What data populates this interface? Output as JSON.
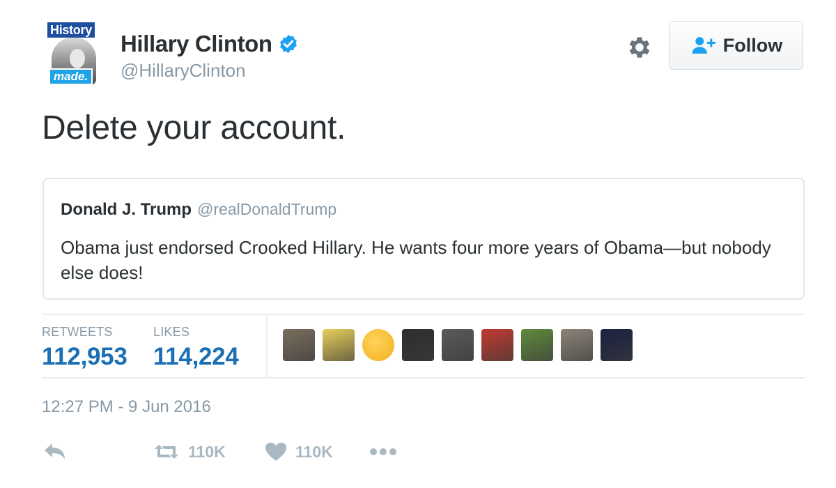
{
  "author": {
    "name": "Hillary Clinton",
    "handle": "@HillaryClinton",
    "avatar_text_top": "History",
    "avatar_text_bottom": "made.",
    "verified": true
  },
  "follow_button": {
    "label": "Follow",
    "icon": "add-user-icon"
  },
  "settings_icon": "gear-icon",
  "tweet": {
    "text": "Delete your account."
  },
  "quoted_tweet": {
    "name": "Donald J. Trump",
    "handle": "@realDonaldTrump",
    "text": "Obama just endorsed Crooked Hillary. He wants four more years of Obama—but nobody else does!"
  },
  "stats": {
    "retweets_label": "RETWEETS",
    "retweets_value": "112,953",
    "likes_label": "LIKES",
    "likes_value": "114,224"
  },
  "liker_avatars": [
    {
      "color": "#7a6e5e",
      "name": "liker-avatar-1"
    },
    {
      "color": "#e8cf5a",
      "name": "liker-avatar-2"
    },
    {
      "color": "#f2b01e",
      "name": "liker-avatar-3"
    },
    {
      "color": "#2e2e2e",
      "name": "liker-avatar-4"
    },
    {
      "color": "#5a5a5a",
      "name": "liker-avatar-5"
    },
    {
      "color": "#c23a2f",
      "name": "liker-avatar-6"
    },
    {
      "color": "#5f8a3c",
      "name": "liker-avatar-7"
    },
    {
      "color": "#8c8478",
      "name": "liker-avatar-8"
    },
    {
      "color": "#1c2140",
      "name": "liker-avatar-9"
    }
  ],
  "timestamp": "12:27 PM - 9 Jun 2016",
  "actions": {
    "reply_icon": "reply-icon",
    "retweet_icon": "retweet-icon",
    "retweet_count": "110K",
    "like_icon": "heart-icon",
    "like_count": "110K",
    "more_icon": "more-dots-icon"
  },
  "colors": {
    "link_blue": "#1b6fb5",
    "muted_gray": "#8899a6",
    "verified_blue": "#1da1f2",
    "border": "#e1e8ed"
  }
}
